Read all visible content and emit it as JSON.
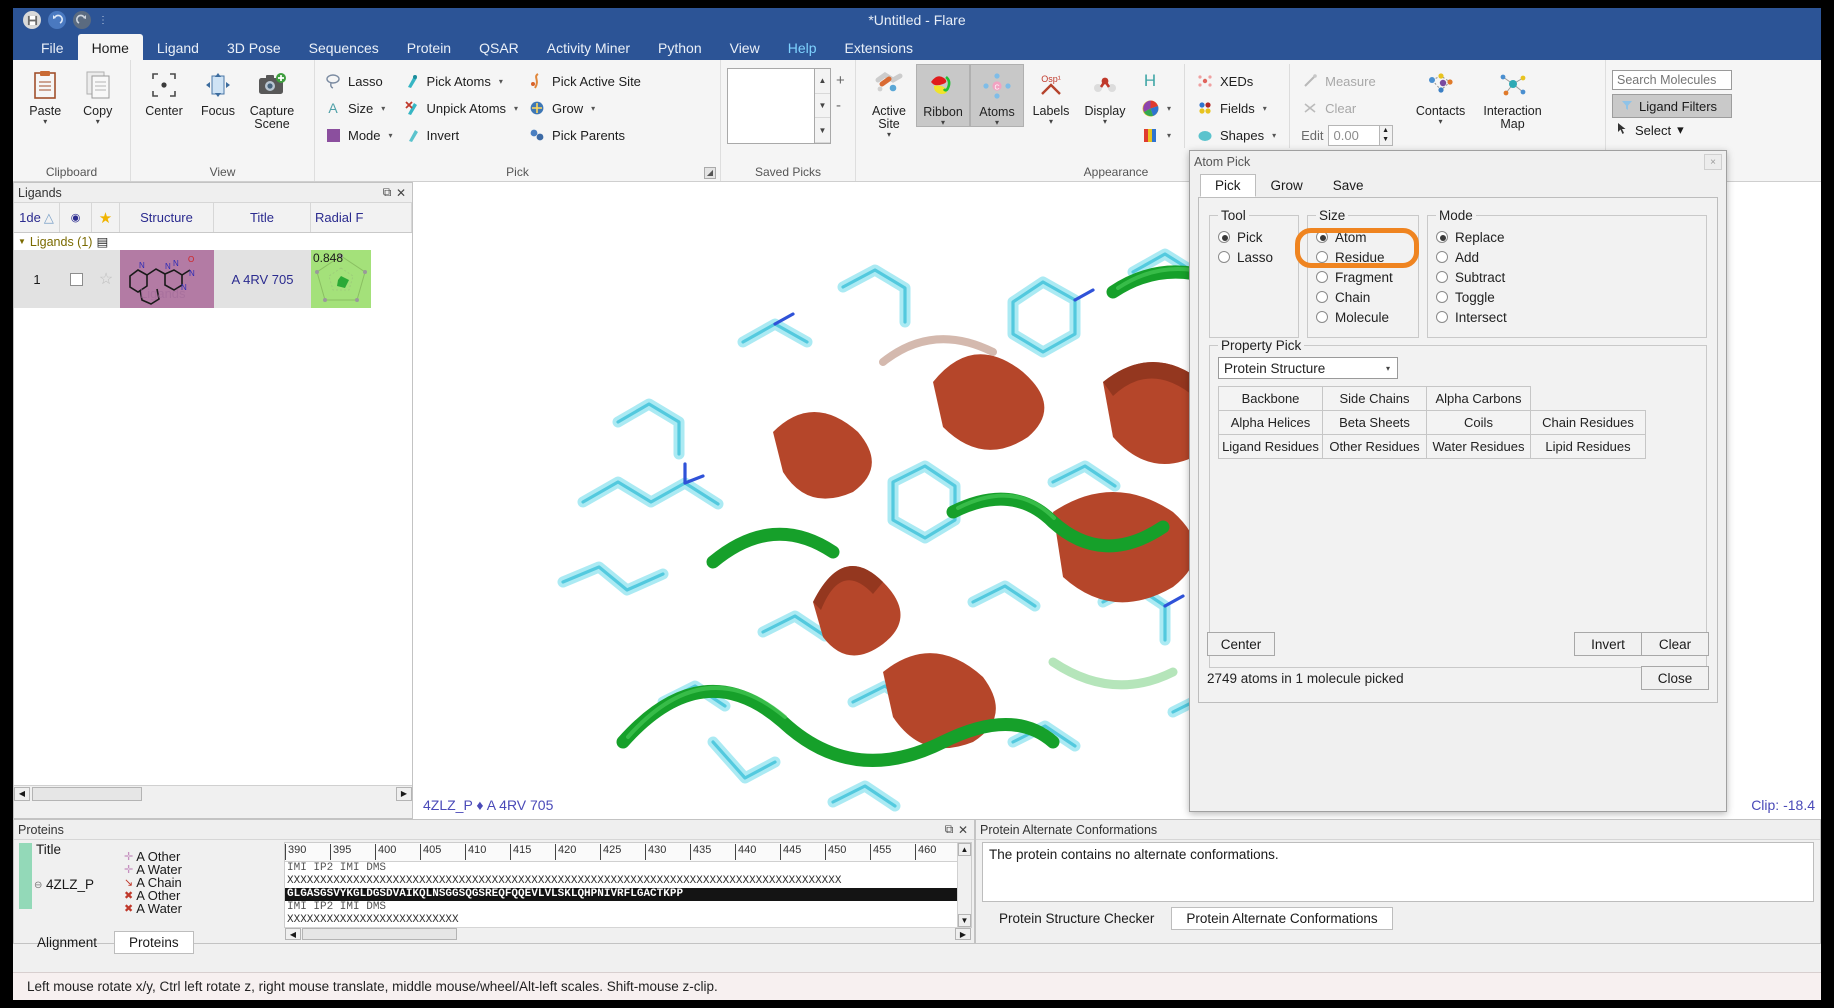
{
  "window": {
    "title": "*Untitled - Flare"
  },
  "quick_access": [
    "save-icon",
    "undo-icon",
    "redo-icon",
    "customize-icon"
  ],
  "tabs": [
    {
      "label": "File",
      "active": false,
      "accent": false
    },
    {
      "label": "Home",
      "active": true,
      "accent": false
    },
    {
      "label": "Ligand",
      "active": false,
      "accent": false
    },
    {
      "label": "3D Pose",
      "active": false,
      "accent": false
    },
    {
      "label": "Sequences",
      "active": false,
      "accent": false
    },
    {
      "label": "Protein",
      "active": false,
      "accent": false
    },
    {
      "label": "QSAR",
      "active": false,
      "accent": false
    },
    {
      "label": "Activity Miner",
      "active": false,
      "accent": false
    },
    {
      "label": "Python",
      "active": false,
      "accent": false
    },
    {
      "label": "View",
      "active": false,
      "accent": false
    },
    {
      "label": "Help",
      "active": false,
      "accent": true
    },
    {
      "label": "Extensions",
      "active": false,
      "accent": false
    }
  ],
  "ribbon": {
    "groups": [
      {
        "name": "Clipboard",
        "label": "Clipboard"
      },
      {
        "name": "View",
        "label": "View"
      },
      {
        "name": "Pick",
        "label": "Pick"
      },
      {
        "name": "SavedPicks",
        "label": "Saved Picks"
      },
      {
        "name": "Appearance",
        "label": "Appearance"
      }
    ],
    "clipboard": [
      {
        "label": "Paste",
        "icon": "paste-icon",
        "caret": true
      },
      {
        "label": "Copy",
        "icon": "copy-icon",
        "caret": true
      }
    ],
    "view": [
      {
        "label": "Center",
        "icon": "center-icon",
        "caret": false
      },
      {
        "label": "Focus",
        "icon": "focus-icon",
        "caret": false
      },
      {
        "label": "Capture Scene",
        "icon": "camera-icon",
        "caret": false
      }
    ],
    "pick_col1": [
      {
        "label": "Lasso",
        "icon": "lasso-icon",
        "caret": false,
        "disabled": false
      },
      {
        "label": "Size",
        "icon": "size-icon",
        "caret": true,
        "disabled": false
      },
      {
        "label": "Mode",
        "icon": "mode-icon",
        "caret": true,
        "disabled": false
      }
    ],
    "pick_col2": [
      {
        "label": "Pick Atoms",
        "icon": "pick-atoms-icon",
        "caret": true,
        "disabled": false
      },
      {
        "label": "Unpick Atoms",
        "icon": "unpick-atoms-icon",
        "caret": true,
        "disabled": false
      },
      {
        "label": "Invert",
        "icon": "invert-icon",
        "caret": false,
        "disabled": false
      }
    ],
    "pick_col3": [
      {
        "label": "Pick Active Site",
        "icon": "pick-active-site-icon",
        "caret": false,
        "disabled": false
      },
      {
        "label": "Grow",
        "icon": "grow-icon",
        "caret": true,
        "disabled": false
      },
      {
        "label": "Pick Parents",
        "icon": "pick-parents-icon",
        "caret": false,
        "disabled": false
      }
    ],
    "saved_picks": {
      "add": "+",
      "remove": "-"
    },
    "appearance_big": [
      {
        "label": "Active Site",
        "icon": "active-site-icon",
        "caret": true,
        "selected": false
      },
      {
        "label": "Ribbon",
        "icon": "ribbon-icon",
        "caret": true,
        "selected": true
      },
      {
        "label": "Atoms",
        "icon": "atoms-icon",
        "caret": true,
        "selected": true
      },
      {
        "label": "Labels",
        "icon": "labels-icon",
        "caret": true,
        "selected": false
      },
      {
        "label": "Display",
        "icon": "display-icon",
        "caret": true,
        "selected": false
      }
    ],
    "appearance_small": [
      {
        "label": "H",
        "icon": "hydrogen-icon",
        "caret": false,
        "disabled": false
      },
      {
        "label": "",
        "icon": "color-wheel-icon",
        "caret": true,
        "disabled": false
      },
      {
        "label": "",
        "icon": "surface-color-icon",
        "caret": true,
        "disabled": false
      }
    ],
    "fields_col": [
      {
        "label": "XEDs",
        "icon": "xeds-icon",
        "caret": false,
        "disabled": false
      },
      {
        "label": "Fields",
        "icon": "fields-icon",
        "caret": true,
        "disabled": false
      },
      {
        "label": "Shapes",
        "icon": "shapes-icon",
        "caret": true,
        "disabled": false
      }
    ],
    "measure_col": [
      {
        "label": "Measure",
        "icon": "measure-icon",
        "caret": false,
        "disabled": true
      },
      {
        "label": "Clear",
        "icon": "clear-measure-icon",
        "caret": false,
        "disabled": true
      }
    ],
    "edit": {
      "label": "Edit",
      "value": "0.00"
    },
    "contacts": [
      {
        "label": "Contacts",
        "icon": "contacts-icon",
        "caret": true
      },
      {
        "label": "Interaction Map",
        "icon": "interaction-map-icon",
        "caret": false
      }
    ],
    "search": {
      "placeholder": "Search Molecules",
      "value": ""
    },
    "ligand_filters": {
      "label": "Ligand Filters",
      "icon": "funnel-icon"
    },
    "select": {
      "label": "Select",
      "icon": "select-icon",
      "caret": true
    }
  },
  "ligands_panel": {
    "title": "Ligands",
    "float_icon": "float-icon",
    "close_icon": "close-icon",
    "columns": [
      "1de",
      "",
      "",
      "Structure",
      "Title",
      "Radial F"
    ],
    "group_label": "Ligands (1)",
    "rows": [
      {
        "num": "1",
        "checked": false,
        "starred": false,
        "structure": "ligand-2d-structure",
        "title": "A 4RV 705",
        "radial": "0.848"
      }
    ],
    "watermark": "Ligands"
  },
  "viewport": {
    "label": "4ZLZ_P ♦ A 4RV 705",
    "clip": "Clip: -18.4",
    "colors": {
      "ribbon": "#b5462a",
      "coil": "#16a02a",
      "sidechain": "#7fdbe8",
      "background": "#ffffff"
    }
  },
  "atom_pick": {
    "title": "Atom Pick",
    "close_label": "×",
    "tabs": [
      {
        "label": "Pick",
        "active": true
      },
      {
        "label": "Grow",
        "active": false
      },
      {
        "label": "Save",
        "active": false
      }
    ],
    "tool": {
      "legend": "Tool",
      "options": [
        {
          "label": "Pick",
          "selected": true
        },
        {
          "label": "Lasso",
          "selected": false
        }
      ]
    },
    "size": {
      "legend": "Size",
      "options": [
        {
          "label": "Atom",
          "selected": true
        },
        {
          "label": "Residue",
          "selected": false
        },
        {
          "label": "Fragment",
          "selected": false
        },
        {
          "label": "Chain",
          "selected": false
        },
        {
          "label": "Molecule",
          "selected": false
        }
      ]
    },
    "mode": {
      "legend": "Mode",
      "options": [
        {
          "label": "Replace",
          "selected": true
        },
        {
          "label": "Add",
          "selected": false
        },
        {
          "label": "Subtract",
          "selected": false
        },
        {
          "label": "Toggle",
          "selected": false
        },
        {
          "label": "Intersect",
          "selected": false
        }
      ]
    },
    "property_pick": {
      "legend": "Property Pick",
      "dropdown_value": "Protein Structure",
      "buttons_rows": [
        [
          "Backbone",
          "Side Chains",
          "Alpha Carbons"
        ],
        [
          "Alpha Helices",
          "Beta Sheets",
          "Coils",
          "Chain Residues"
        ],
        [
          "Ligand Residues",
          "Other Residues",
          "Water Residues",
          "Lipid Residues"
        ]
      ],
      "highlighted": "Side Chains",
      "highlight_color": "#ef8420"
    },
    "footer": {
      "center": "Center",
      "invert": "Invert",
      "clear": "Clear",
      "close": "Close",
      "status": "2749 atoms in 1 molecule picked"
    }
  },
  "proteins_panel": {
    "title": "Proteins",
    "float_icon": "float-icon",
    "close_icon": "close-icon",
    "header_col": "Title",
    "entry": "4ZLZ_P",
    "tracks": [
      {
        "icon": "cross-dim-icon",
        "label": "A Other"
      },
      {
        "icon": "cross-dim-icon",
        "label": "A Water"
      },
      {
        "icon": "chain-icon",
        "label": "A Chain"
      },
      {
        "icon": "cross-red-icon",
        "label": "A Other"
      },
      {
        "icon": "cross-red-icon",
        "label": "A Water"
      }
    ],
    "ruler_ticks": [
      "390",
      "395",
      "400",
      "405",
      "410",
      "415",
      "420",
      "425",
      "430",
      "435",
      "440",
      "445",
      "450",
      "455",
      "460"
    ],
    "sequence_lines": [
      "IMI IP2 IMI DMS",
      "XXXXXXXXXXXXXXXXXXXXXXXXXXXXXXXXXXXXXXXXXXXXXXXXXXXXXXXXXXXXXXXXXXXXXXXXXXXXXXXXXXXX",
      "GLGASGSVYKGLDGSDVAIKQLNSGGSQGSREQFQQEVLVLSKLQHPNIVRFLGACTKPP",
      "IMI IP2 IMI DMS",
      "XXXXXXXXXXXXXXXXXXXXXXXXXX"
    ],
    "tabs": [
      {
        "label": "Alignment",
        "active": false
      },
      {
        "label": "Proteins",
        "active": true
      }
    ]
  },
  "alt_conf_panel": {
    "title": "Protein Alternate Conformations",
    "message": "The protein contains no alternate conformations.",
    "tabs": [
      {
        "label": "Protein Structure Checker",
        "active": false
      },
      {
        "label": "Protein Alternate Conformations",
        "active": true
      }
    ]
  },
  "status_bar": {
    "text": "Left mouse rotate x/y, Ctrl left rotate z, right mouse translate, middle mouse/wheel/Alt-left scales. Shift-mouse z-clip."
  }
}
